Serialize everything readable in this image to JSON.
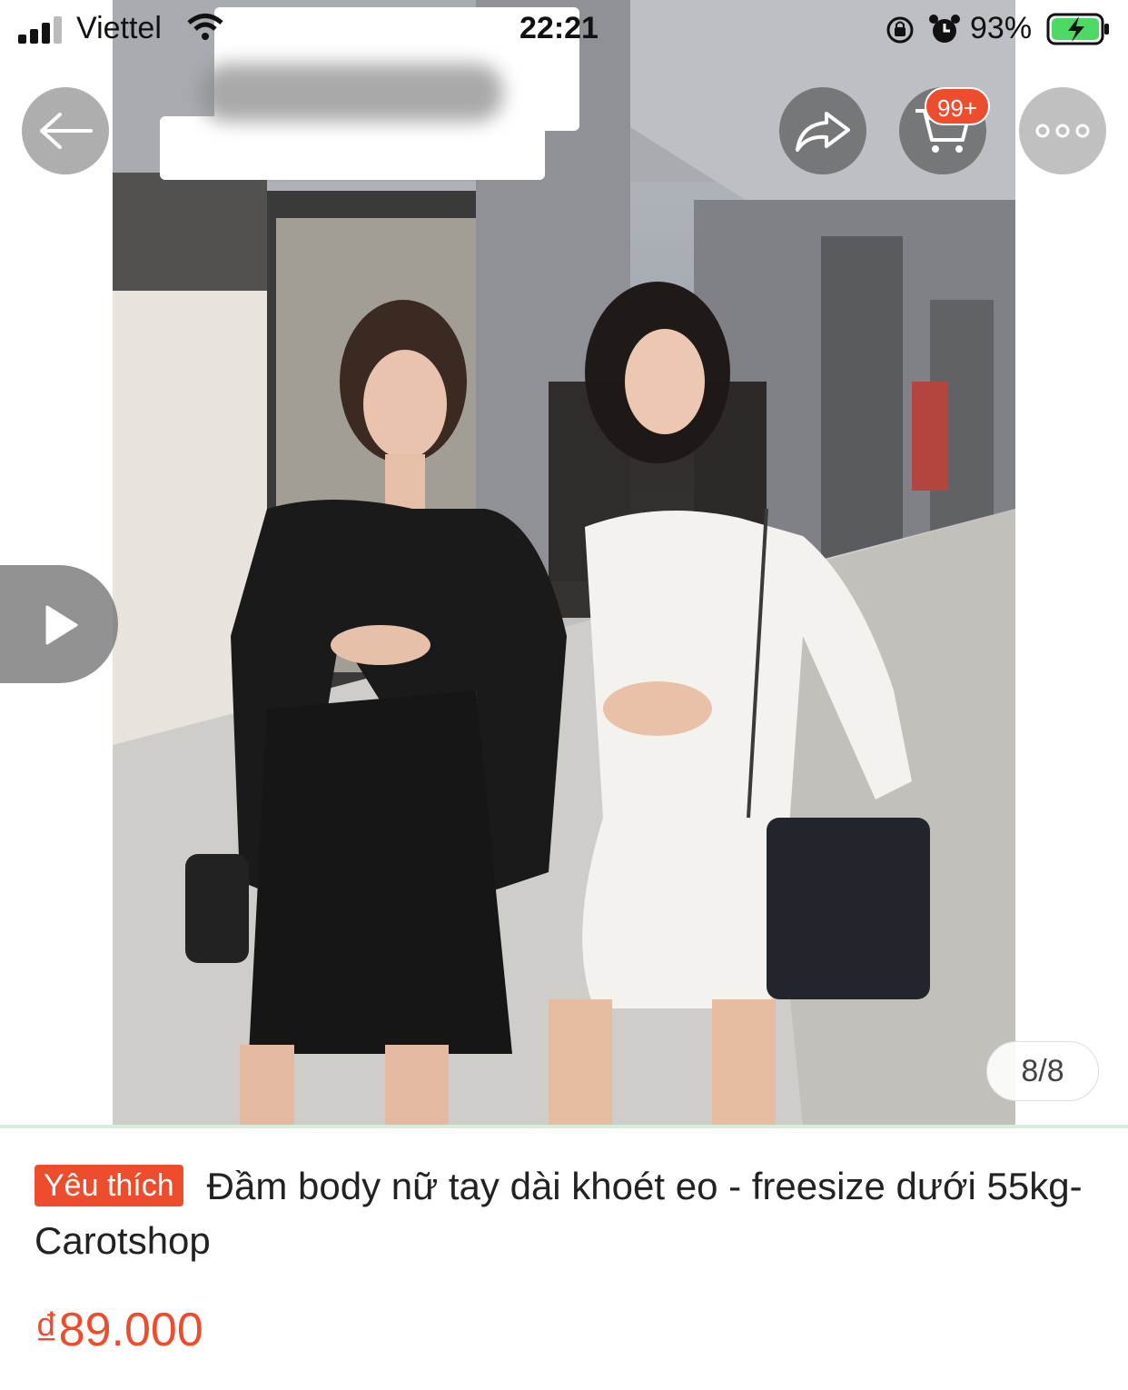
{
  "status_bar": {
    "carrier": "Viettel",
    "time": "22:21",
    "battery_percent": "93%"
  },
  "nav": {
    "cart_badge": "99+"
  },
  "gallery": {
    "counter": "8/8",
    "current_image": 8,
    "total_images": 8
  },
  "product": {
    "tag": "Yêu thích",
    "title": "Đầm body nữ tay dài khoét eo - freesize dưới 55kg- Carotshop",
    "price": "₫89.000"
  },
  "colors": {
    "accent": "#ee4d2d"
  }
}
